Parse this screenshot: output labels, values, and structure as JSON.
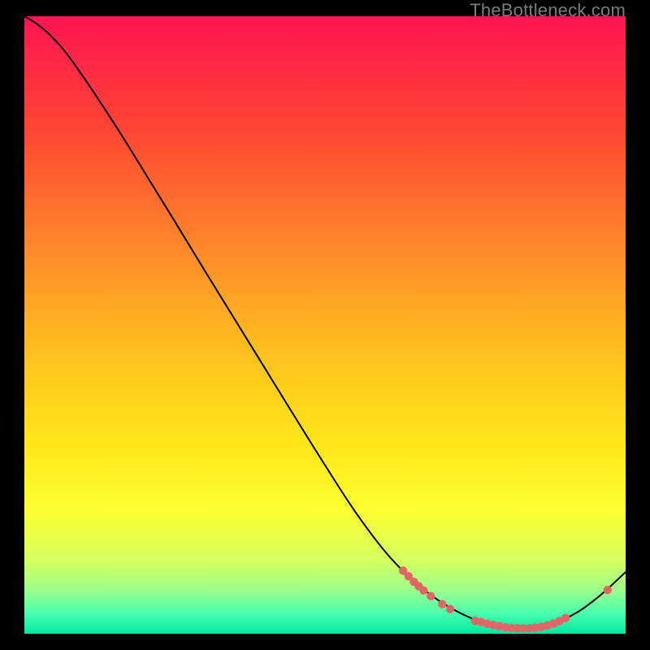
{
  "watermark": "TheBottleneck.com",
  "chart_data": {
    "type": "line",
    "xlim": [
      0,
      100
    ],
    "ylim": [
      0,
      100
    ],
    "gradient_stops": [
      {
        "offset": 0.0,
        "color": "#ff1452"
      },
      {
        "offset": 0.18,
        "color": "#ff4534"
      },
      {
        "offset": 0.38,
        "color": "#ff8a2a"
      },
      {
        "offset": 0.55,
        "color": "#ffc21e"
      },
      {
        "offset": 0.7,
        "color": "#ffe81a"
      },
      {
        "offset": 0.8,
        "color": "#fcff32"
      },
      {
        "offset": 0.88,
        "color": "#d6ff5e"
      },
      {
        "offset": 0.93,
        "color": "#9bff8c"
      },
      {
        "offset": 0.965,
        "color": "#4effae"
      },
      {
        "offset": 1.0,
        "color": "#00e8a2"
      }
    ],
    "curve": [
      {
        "x": 0.0,
        "y": 100.0
      },
      {
        "x": 2.0,
        "y": 98.8
      },
      {
        "x": 4.0,
        "y": 97.2
      },
      {
        "x": 6.5,
        "y": 94.6
      },
      {
        "x": 9.0,
        "y": 91.3
      },
      {
        "x": 12.0,
        "y": 87.0
      },
      {
        "x": 16.0,
        "y": 81.0
      },
      {
        "x": 20.0,
        "y": 74.7
      },
      {
        "x": 25.0,
        "y": 66.8
      },
      {
        "x": 30.0,
        "y": 58.8
      },
      {
        "x": 35.0,
        "y": 50.9
      },
      {
        "x": 40.0,
        "y": 43.0
      },
      {
        "x": 45.0,
        "y": 35.1
      },
      {
        "x": 50.0,
        "y": 27.3
      },
      {
        "x": 55.0,
        "y": 19.8
      },
      {
        "x": 60.0,
        "y": 13.3
      },
      {
        "x": 64.0,
        "y": 9.2
      },
      {
        "x": 68.0,
        "y": 6.0
      },
      {
        "x": 72.0,
        "y": 3.6
      },
      {
        "x": 76.0,
        "y": 1.9
      },
      {
        "x": 80.0,
        "y": 1.0
      },
      {
        "x": 84.0,
        "y": 0.9
      },
      {
        "x": 88.0,
        "y": 1.7
      },
      {
        "x": 92.0,
        "y": 3.5
      },
      {
        "x": 96.0,
        "y": 6.4
      },
      {
        "x": 100.0,
        "y": 10.0
      }
    ],
    "markers": [
      {
        "x": 63.0,
        "y": 10.2
      },
      {
        "x": 63.9,
        "y": 9.3
      },
      {
        "x": 64.8,
        "y": 8.4
      },
      {
        "x": 65.6,
        "y": 7.7
      },
      {
        "x": 66.4,
        "y": 7.0
      },
      {
        "x": 67.6,
        "y": 6.1
      },
      {
        "x": 69.5,
        "y": 4.8
      },
      {
        "x": 70.8,
        "y": 4.0
      },
      {
        "x": 75.0,
        "y": 2.1
      },
      {
        "x": 76.0,
        "y": 1.9
      },
      {
        "x": 77.0,
        "y": 1.6
      },
      {
        "x": 78.0,
        "y": 1.4
      },
      {
        "x": 79.0,
        "y": 1.2
      },
      {
        "x": 80.0,
        "y": 1.05
      },
      {
        "x": 81.0,
        "y": 0.95
      },
      {
        "x": 82.0,
        "y": 0.9
      },
      {
        "x": 83.0,
        "y": 0.88
      },
      {
        "x": 84.0,
        "y": 0.9
      },
      {
        "x": 85.0,
        "y": 0.98
      },
      {
        "x": 86.0,
        "y": 1.12
      },
      {
        "x": 87.0,
        "y": 1.35
      },
      {
        "x": 88.0,
        "y": 1.65
      },
      {
        "x": 89.0,
        "y": 2.05
      },
      {
        "x": 90.0,
        "y": 2.55
      },
      {
        "x": 97.0,
        "y": 7.1
      }
    ],
    "marker_color": "#e26666",
    "curve_color": "#000000"
  }
}
